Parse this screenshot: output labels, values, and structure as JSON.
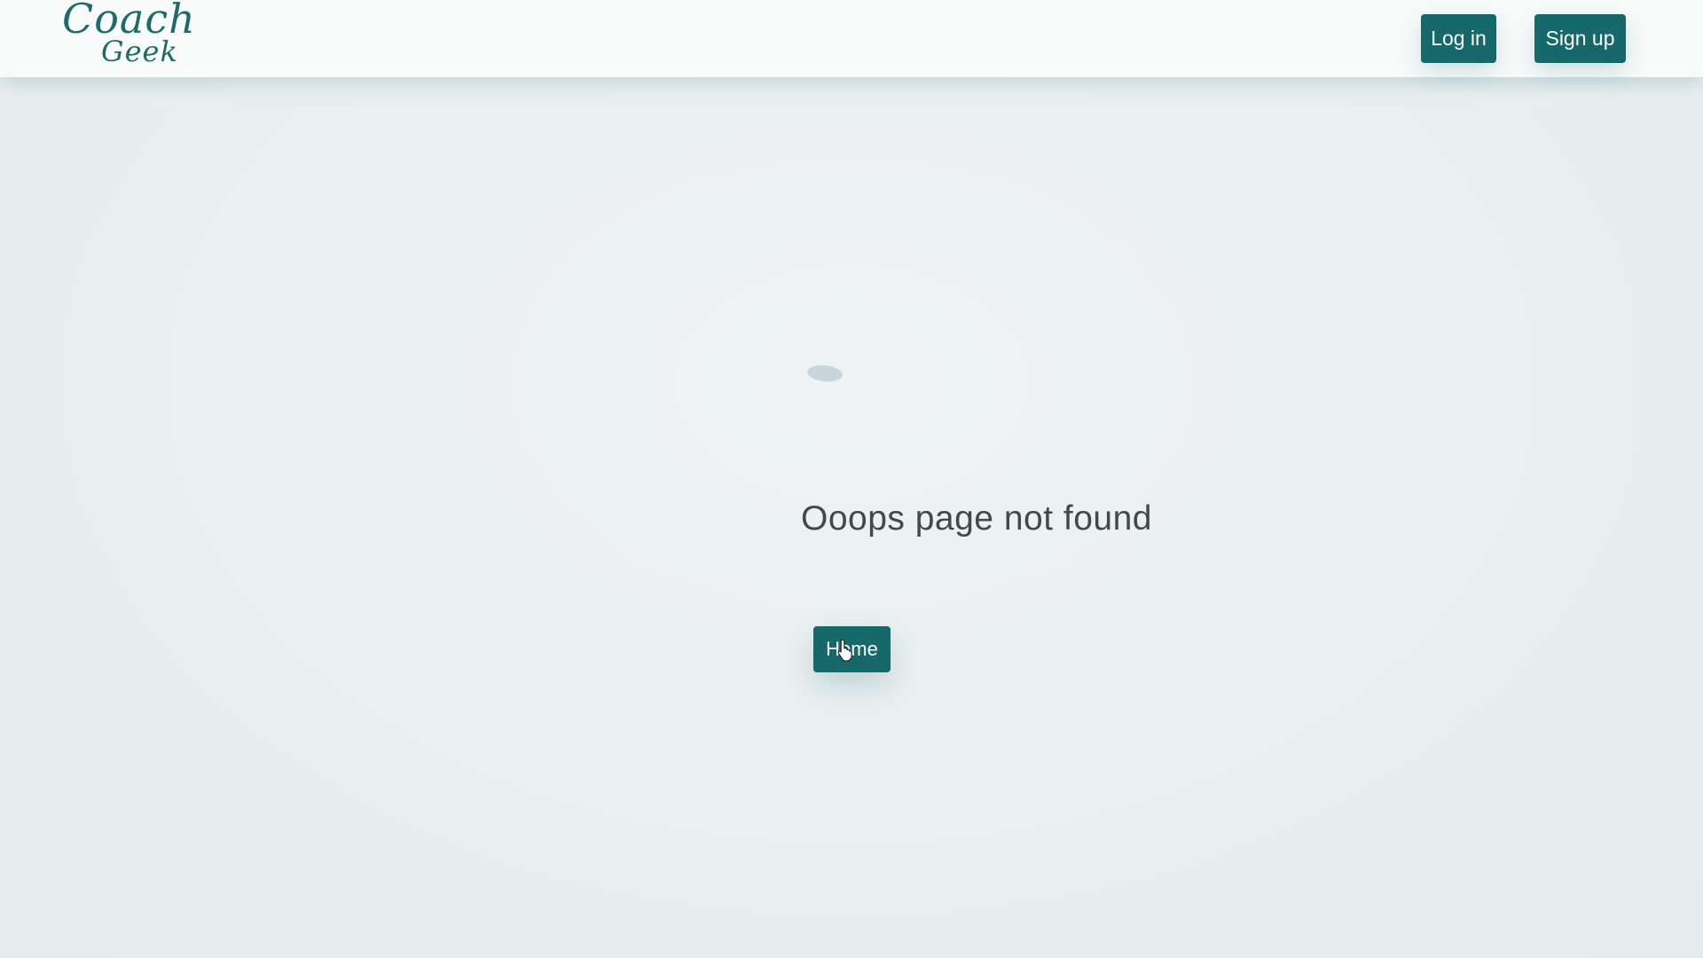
{
  "header": {
    "logo_line1": "Coach",
    "logo_line2": "Geek",
    "login_label": "Log in",
    "signup_label": "Sign up"
  },
  "main": {
    "message": "Ooops page not found",
    "home_label": "Home"
  },
  "colors": {
    "accent": "#17686b",
    "background": "#ebf0f1",
    "text": "#3f4a4d"
  },
  "icons": {
    "cursor": "hand-pointer-icon"
  }
}
